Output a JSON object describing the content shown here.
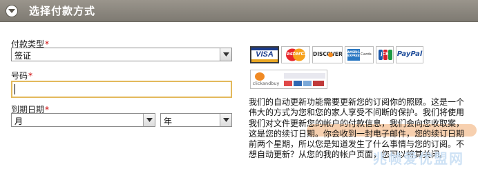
{
  "header": {
    "title": "选择付款方式"
  },
  "form": {
    "payment_type": {
      "label": "付款类型",
      "required": "*",
      "value": "签证"
    },
    "number": {
      "label": "号码",
      "required": "*",
      "value": ""
    },
    "expiry": {
      "label": "到期日期",
      "required": "*",
      "month_value": "月",
      "year_value": "年"
    }
  },
  "cards": {
    "visa": "VISA",
    "mastercard": "MasterCard",
    "discover": "DISCOVER",
    "amex": "AMERICAN EXPRESS",
    "cards_small": "Cards",
    "jcb": "JCB",
    "paypal": "PayPal",
    "clickandbuy": "clickandbuy"
  },
  "description": "我们的自动更新功能需要更新您的订阅你的照顾。这是一个伟大的方式为您和您的家人享受不间断的保护。我们将使用我们对文件更新您的帐户的付款信息，我们会向您收取案，这是您的续订日期。你会收到一封电子邮件，您的续订日期前两个星期，所以您是知道发生了什么事情与您的订阅。不想自动更新？从您的我的帐户页面，您可以将其关闭。",
  "watermark": "兆帧爱优盟网"
}
